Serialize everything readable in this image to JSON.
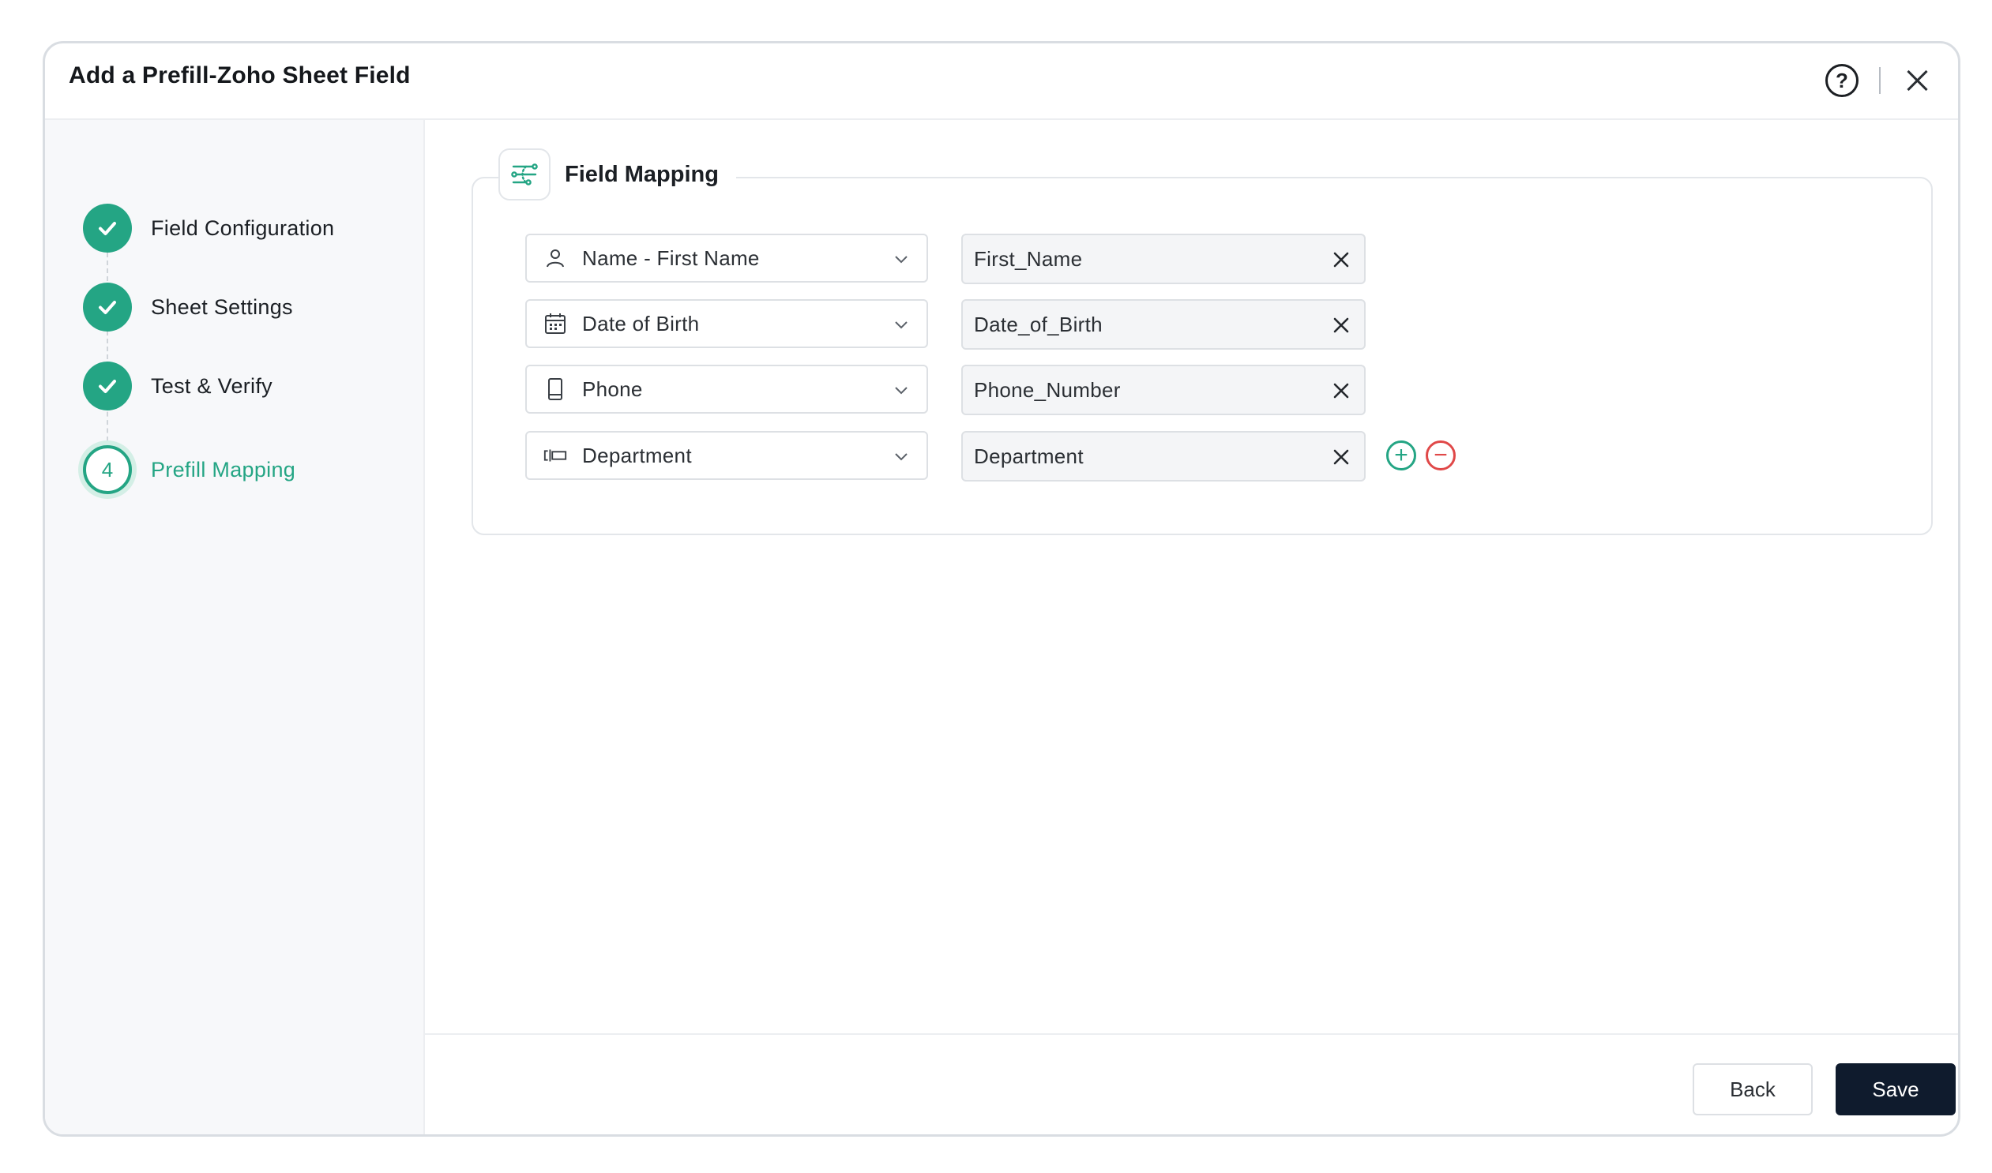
{
  "dialog": {
    "title": "Add a Prefill-Zoho Sheet Field",
    "help_glyph": "?"
  },
  "steps": [
    {
      "label": "Field Configuration",
      "state": "done"
    },
    {
      "label": "Sheet Settings",
      "state": "done"
    },
    {
      "label": "Test & Verify",
      "state": "done"
    },
    {
      "label": "Prefill Mapping",
      "state": "active",
      "number": "4"
    }
  ],
  "mapping": {
    "title": "Field Mapping",
    "rows": [
      {
        "field": "Name - First Name",
        "icon": "person-icon",
        "column": "First_Name"
      },
      {
        "field": "Date of Birth",
        "icon": "calendar-icon",
        "column": "Date_of_Birth"
      },
      {
        "field": "Phone",
        "icon": "phone-icon",
        "column": "Phone_Number"
      },
      {
        "field": "Department",
        "icon": "department-icon",
        "column": "Department"
      }
    ],
    "add_glyph": "+",
    "remove_glyph": "−"
  },
  "footer": {
    "back_label": "Back",
    "save_label": "Save"
  },
  "colors": {
    "accent": "#24a584",
    "danger": "#e04848",
    "primary_button": "#0f1b2d"
  }
}
